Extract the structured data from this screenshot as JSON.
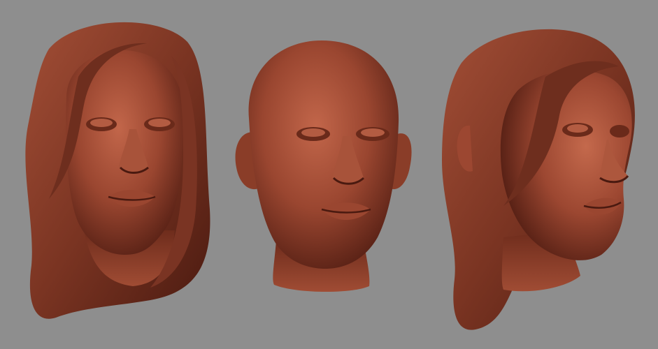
{
  "scene": {
    "background_color": "#8e8e8e",
    "clay_base_color": "#8a3e2a",
    "clay_highlight_color": "#c2664a",
    "clay_shadow_color": "#3e160c",
    "views": [
      {
        "view": "front",
        "hair": true
      },
      {
        "view": "front",
        "hair": false
      },
      {
        "view": "three-quarter",
        "hair": true
      }
    ]
  }
}
